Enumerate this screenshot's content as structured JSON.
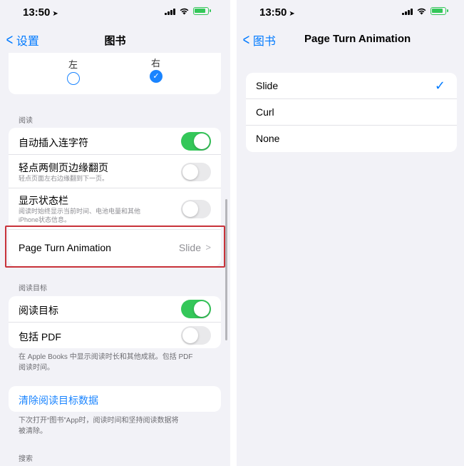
{
  "status_bar": {
    "time": "13:50"
  },
  "left": {
    "nav": {
      "back_label": "设置",
      "title": "图书"
    },
    "direction": {
      "left_label": "左",
      "right_label": "右",
      "selected": "右"
    },
    "reading": {
      "header": "阅读",
      "auto_hyphen": {
        "label": "自动插入连字符",
        "on": true
      },
      "tap_margins": {
        "label": "轻点两侧页边缘翻页",
        "sub": "轻点页面左右边缘翻到下一页。",
        "on": false
      },
      "show_status": {
        "label": "显示状态栏",
        "sub1": "阅读时始终显示当前时间、电池电量和其他",
        "sub2": "iPhone状态信息。",
        "on": false
      },
      "page_turn": {
        "label": "Page Turn Animation",
        "value": "Slide"
      }
    },
    "goals": {
      "header": "阅读目标",
      "reading_goals": {
        "label": "阅读目标",
        "on": true
      },
      "include_pdf": {
        "label": "包括 PDF",
        "on": false
      },
      "footer1": "在 Apple Books 中显示阅读时长和其他成就。包括 PDF",
      "footer2": "阅读时间。"
    },
    "clear": {
      "label": "清除阅读目标数据",
      "footer1": "下次打开“图书”App时，阅读时间和坚持阅读数据将",
      "footer2": "被清除。"
    },
    "search": {
      "header": "搜索"
    }
  },
  "right": {
    "nav": {
      "back_label": "图书",
      "title": "Page Turn Animation"
    },
    "options": [
      {
        "label": "Slide",
        "selected": true
      },
      {
        "label": "Curl",
        "selected": false
      },
      {
        "label": "None",
        "selected": false
      }
    ]
  },
  "colors": {
    "accent": "#007aff",
    "toggle_on": "#34c759",
    "highlight": "#c8323a"
  }
}
